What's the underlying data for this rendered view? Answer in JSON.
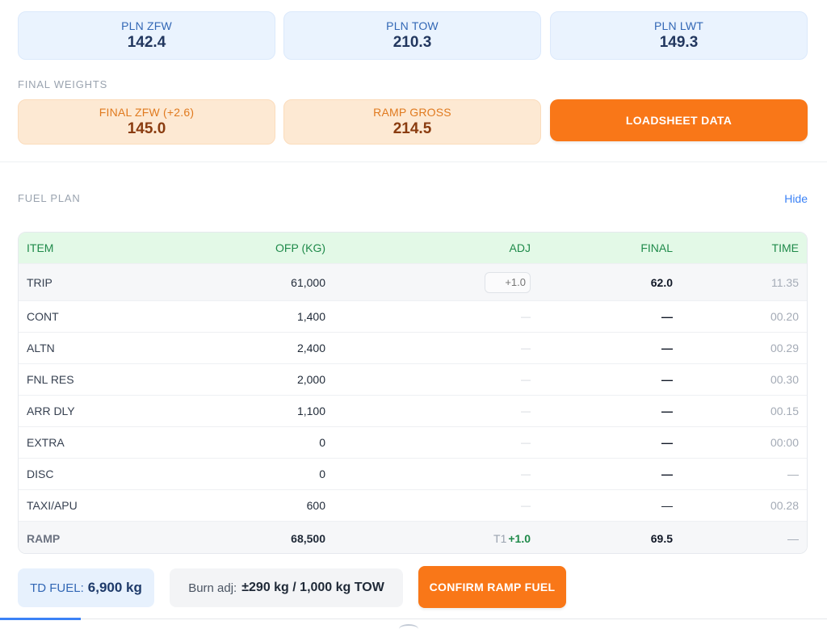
{
  "weights": {
    "pln_zfw": {
      "label": "PLN ZFW",
      "value": "142.4"
    },
    "pln_tow": {
      "label": "PLN TOW",
      "value": "210.3"
    },
    "pln_lwt": {
      "label": "PLN LWT",
      "value": "149.3"
    }
  },
  "final_weights": {
    "section_label": "FINAL WEIGHTS",
    "final_zfw": {
      "label": "FINAL ZFW (+2.6)",
      "value": "145.0"
    },
    "ramp_gross": {
      "label": "RAMP GROSS",
      "value": "214.5"
    },
    "loadsheet_button": "LOADSHEET DATA"
  },
  "fuel_plan": {
    "section_label": "FUEL PLAN",
    "hide_link": "Hide",
    "columns": {
      "item": "ITEM",
      "ofp": "OFP (KG)",
      "adj": "ADJ",
      "final": "FINAL",
      "time": "TIME"
    },
    "rows": [
      {
        "item": "TRIP",
        "ofp": "61,000",
        "adj_placeholder": "+1.0",
        "final": "62.0",
        "time": "11.35"
      },
      {
        "item": "CONT",
        "ofp": "1,400",
        "adj": "—",
        "final": "—",
        "time": "00.20"
      },
      {
        "item": "ALTN",
        "ofp": "2,400",
        "adj": "—",
        "final": "—",
        "time": "00.29"
      },
      {
        "item": "FNL RES",
        "ofp": "2,000",
        "adj": "—",
        "final": "—",
        "time": "00.30"
      },
      {
        "item": "ARR DLY",
        "ofp": "1,100",
        "adj": "—",
        "final": "—",
        "time": "00.15"
      },
      {
        "item": "EXTRA",
        "ofp": "0",
        "adj": "—",
        "final": "—",
        "time": "00:00"
      },
      {
        "item": "DISC",
        "ofp": "0",
        "adj": "—",
        "final": "—",
        "time": "—"
      },
      {
        "item": "TAXI/APU",
        "ofp": "600",
        "adj": "—",
        "final": "—",
        "time": "00.28"
      }
    ],
    "ramp": {
      "item": "RAMP",
      "ofp": "68,500",
      "adj_prefix": "T1",
      "adj_value": "+1.0",
      "final": "69.5",
      "time": "—"
    }
  },
  "summary": {
    "td_fuel_label": "TD FUEL:",
    "td_fuel_value": "6,900 kg",
    "burn_adj_label": "Burn adj:",
    "burn_adj_value": "±290 kg / 1,000 kg TOW",
    "confirm_button": "CONFIRM RAMP FUEL"
  },
  "colors": {
    "accent_orange": "#f97718",
    "header_green": "#1f8a4a",
    "link_blue": "#3b82f6"
  }
}
